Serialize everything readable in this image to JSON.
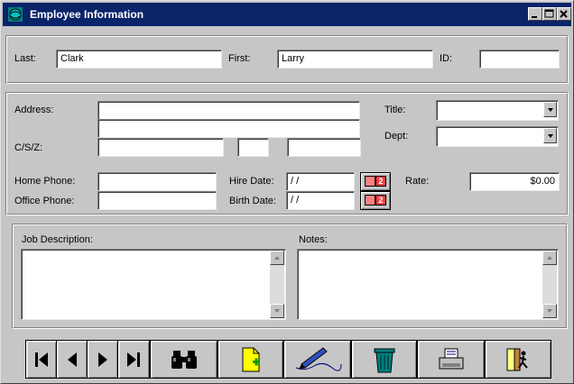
{
  "window": {
    "title": "Employee Information"
  },
  "name_row": {
    "last_label": "Last:",
    "last_value": "Clark",
    "first_label": "First:",
    "first_value": "Larry",
    "id_label": "ID:",
    "id_value": ""
  },
  "address": {
    "address_label": "Address:",
    "address_line1": "",
    "address_line2": "",
    "csz_label": "C/S/Z:",
    "city": "",
    "state": "",
    "zip": "",
    "title_label": "Title:",
    "title_value": "",
    "dept_label": "Dept:",
    "dept_value": "",
    "home_phone_label": "Home Phone:",
    "home_phone": "",
    "office_phone_label": "Office Phone:",
    "office_phone": "",
    "hire_date_label": "Hire Date:",
    "hire_date": " / /",
    "birth_date_label": "Birth Date:",
    "birth_date": " / /",
    "rate_label": "Rate:",
    "rate_value": "$0.00"
  },
  "memos": {
    "job_description_label": "Job Description:",
    "notes_label": "Notes:"
  },
  "toolbar": {
    "buttons": [
      "first-record",
      "previous-record",
      "next-record",
      "last-record",
      "find",
      "new-record",
      "edit",
      "delete",
      "print",
      "exit"
    ]
  },
  "colors": {
    "titlebar": "#0a246a",
    "window_bg": "#c6c6c6",
    "calendar_accent": "#ff4040"
  }
}
